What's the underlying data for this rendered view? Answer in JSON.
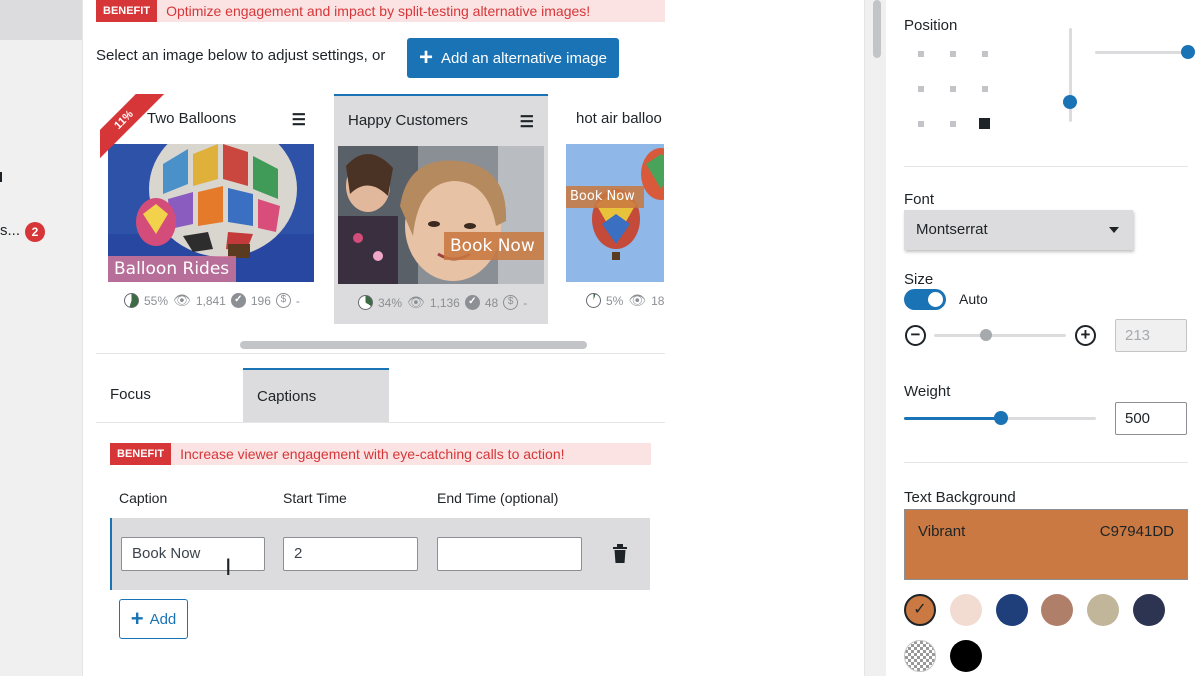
{
  "sidebar": {
    "item_text": "s...",
    "badge_count": "2"
  },
  "top_benefit": {
    "tag": "BENEFIT",
    "text": "Optimize engagement and impact by split-testing alternative images!"
  },
  "select_prompt": "Select an image below to adjust settings, or",
  "add_alt_button": "Add an alternative image",
  "cards": [
    {
      "title": "Two Balloons",
      "ribbon": "11%",
      "caption": "Balloon Rides",
      "stat_pct": "55%",
      "views": "1,841",
      "conversions": "196",
      "revenue": "-"
    },
    {
      "title": "Happy Customers",
      "caption": "Book Now",
      "stat_pct": "34%",
      "views": "1,136",
      "conversions": "48",
      "revenue": "-"
    },
    {
      "title": "hot air balloo",
      "caption": "Book Now",
      "stat_pct": "5%",
      "views": "18"
    }
  ],
  "tabs": {
    "focus": "Focus",
    "captions": "Captions"
  },
  "captions_benefit": {
    "tag": "BENEFIT",
    "text": "Increase viewer engagement with eye-catching calls to action!"
  },
  "caption_table": {
    "headers": {
      "caption": "Caption",
      "start": "Start Time",
      "end": "End Time (optional)"
    },
    "rows": [
      {
        "caption": "Book Now",
        "start": "2",
        "end": ""
      }
    ],
    "add_label": "Add"
  },
  "settings": {
    "position_label": "Position",
    "position_selected": "bottom-right",
    "font_label": "Font",
    "font_value": "Montserrat",
    "size_label": "Size",
    "size_auto_label": "Auto",
    "size_auto_on": true,
    "size_value": "213",
    "weight_label": "Weight",
    "weight_value": "500",
    "text_bg_label": "Text Background",
    "text_bg_name": "Vibrant",
    "text_bg_hex": "C97941DD",
    "swatches": [
      "#c97941",
      "#f2dcd2",
      "#1f3f7a",
      "#b07f6a",
      "#c1b59a",
      "#2d3452",
      "transparent",
      "#000000"
    ]
  },
  "colors": {
    "accent": "#1a73b5",
    "danger": "#d63638",
    "text_bg": "#c97941"
  }
}
